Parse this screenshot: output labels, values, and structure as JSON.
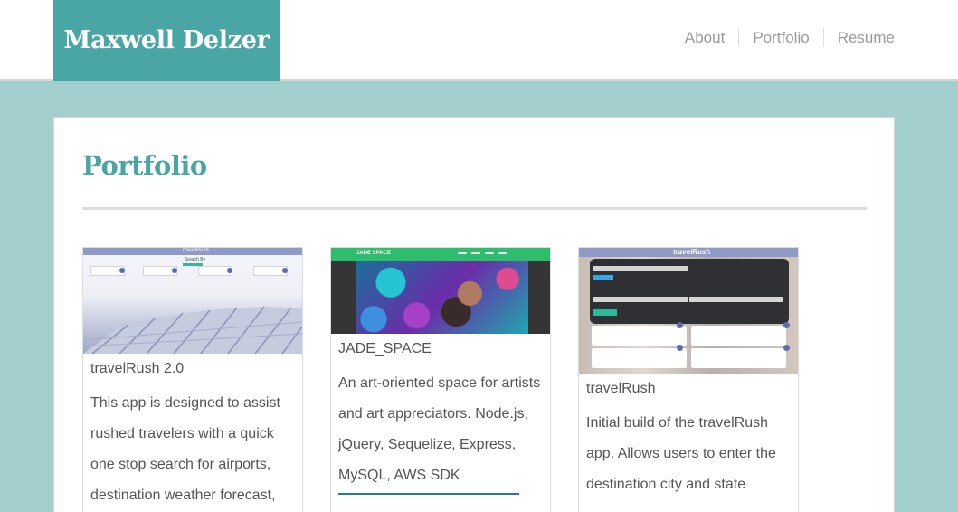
{
  "header": {
    "brand": "Maxwell Delzer",
    "nav": [
      "About",
      "Portfolio",
      "Resume"
    ]
  },
  "page": {
    "title": "Portfolio"
  },
  "projects": [
    {
      "title": "travelRush 2.0",
      "description": "This app is designed to assist rushed travelers with a quick one stop search for airports, destination weather forecast,",
      "thumb_title": "travelRush",
      "thumb_heading": "Search By"
    },
    {
      "title": "JADE_SPACE",
      "description": "An art-oriented space for artists and art appreciators. Node.js, jQuery, Sequelize, Express, MySQL, AWS SDK",
      "thumb_brand": "JADE SPACE"
    },
    {
      "title": "travelRush",
      "description": "Initial build of the travelRush app. Allows users to enter the destination city and state",
      "thumb_title": "travelRush"
    }
  ],
  "colors": {
    "accent": "#4aa6a4",
    "background": "#a3cfcf",
    "nav_text": "#9b9b9b",
    "body_text": "#555555"
  }
}
